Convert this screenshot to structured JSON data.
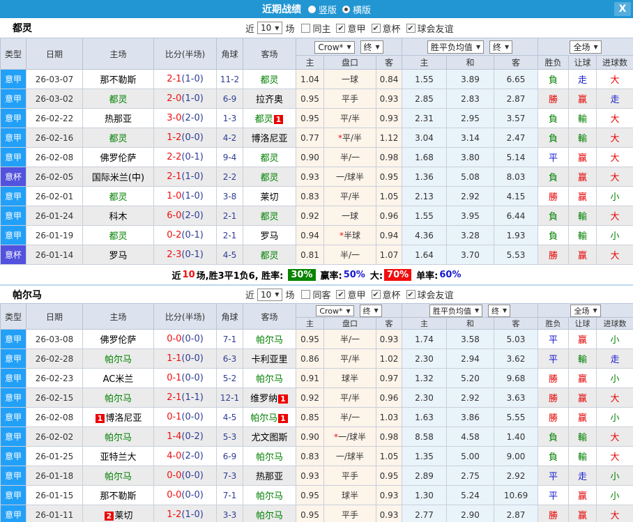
{
  "topbar": {
    "title": "近期战绩",
    "radio_vertical": "竖版",
    "radio_horizontal": "横版",
    "close_label": "X"
  },
  "filter_labels": {
    "near": "近",
    "games": "场"
  },
  "dropdowns": {
    "book": "Crow*",
    "book_time": "终",
    "avg": "胜平负均值",
    "avg_time": "终",
    "scope": "全场",
    "arrow": "▼"
  },
  "columns": {
    "type": "类型",
    "date": "日期",
    "home": "主场",
    "score": "比分(半场)",
    "corners": "角球",
    "away": "客场",
    "odds_home": "主",
    "handicap": "盘口",
    "odds_away": "客",
    "avg_home": "主",
    "avg_draw": "和",
    "avg_away": "客",
    "wdl": "胜负",
    "hcp_result": "让球",
    "goals": "进球数"
  },
  "colors": {
    "league_blue": "#22a0f8",
    "cup_purple": "#5252de",
    "win_red": "#e60000",
    "lose_green": "#008000",
    "draw_blue": "#1518cf",
    "topbar_blue": "#2196d3"
  },
  "sections": [
    {
      "team": "都灵",
      "filter": {
        "count": "10",
        "same": "同主",
        "leagues": [
          "意甲",
          "意杯",
          "球会友谊"
        ]
      },
      "rows": [
        {
          "lg": "意甲",
          "cup": false,
          "date": "26-03-07",
          "home": {
            "t": "那不勒斯"
          },
          "ft": "2-1",
          "ht": "(1-0)",
          "cr": "11-2",
          "away": {
            "t": "都灵",
            "g": true
          },
          "o1": "1.04",
          "hc": "一球",
          "star": false,
          "o2": "0.84",
          "avg": [
            "1.55",
            "3.89",
            "6.65"
          ],
          "res": [
            [
              "負",
              "g"
            ],
            [
              "走",
              "b"
            ],
            [
              "大",
              "r"
            ]
          ]
        },
        {
          "lg": "意甲",
          "cup": false,
          "date": "26-03-02",
          "home": {
            "t": "都灵",
            "g": true
          },
          "ft": "2-0",
          "ht": "(1-0)",
          "cr": "6-9",
          "away": {
            "t": "拉齐奥"
          },
          "o1": "0.95",
          "hc": "平手",
          "star": false,
          "o2": "0.93",
          "avg": [
            "2.85",
            "2.83",
            "2.87"
          ],
          "res": [
            [
              "勝",
              "r"
            ],
            [
              "赢",
              "r"
            ],
            [
              "走",
              "b"
            ]
          ]
        },
        {
          "lg": "意甲",
          "cup": false,
          "date": "26-02-22",
          "home": {
            "t": "热那亚"
          },
          "ft": "3-0",
          "ht": "(2-0)",
          "cr": "1-3",
          "away": {
            "t": "都灵",
            "g": true,
            "b": "1",
            "bp": "after"
          },
          "o1": "0.95",
          "hc": "平/半",
          "star": false,
          "o2": "0.93",
          "avg": [
            "2.31",
            "2.95",
            "3.57"
          ],
          "res": [
            [
              "負",
              "g"
            ],
            [
              "輸",
              "g"
            ],
            [
              "大",
              "r"
            ]
          ]
        },
        {
          "lg": "意甲",
          "cup": false,
          "date": "26-02-16",
          "home": {
            "t": "都灵",
            "g": true
          },
          "ft": "1-2",
          "ht": "(0-0)",
          "cr": "4-2",
          "away": {
            "t": "博洛尼亚"
          },
          "o1": "0.77",
          "hc": "平/半",
          "star": true,
          "o2": "1.12",
          "avg": [
            "3.04",
            "3.14",
            "2.47"
          ],
          "res": [
            [
              "負",
              "g"
            ],
            [
              "輸",
              "g"
            ],
            [
              "大",
              "r"
            ]
          ]
        },
        {
          "lg": "意甲",
          "cup": false,
          "date": "26-02-08",
          "home": {
            "t": "佛罗伦萨"
          },
          "ft": "2-2",
          "ht": "(0-1)",
          "cr": "9-4",
          "away": {
            "t": "都灵",
            "g": true
          },
          "o1": "0.90",
          "hc": "半/一",
          "star": false,
          "o2": "0.98",
          "avg": [
            "1.68",
            "3.80",
            "5.14"
          ],
          "res": [
            [
              "平",
              "b"
            ],
            [
              "赢",
              "r"
            ],
            [
              "大",
              "r"
            ]
          ]
        },
        {
          "lg": "意杯",
          "cup": true,
          "date": "26-02-05",
          "home": {
            "t": "国际米兰(中)"
          },
          "ft": "2-1",
          "ht": "(1-0)",
          "cr": "2-2",
          "away": {
            "t": "都灵",
            "g": true
          },
          "o1": "0.93",
          "hc": "一/球半",
          "star": false,
          "o2": "0.95",
          "avg": [
            "1.36",
            "5.08",
            "8.03"
          ],
          "res": [
            [
              "負",
              "g"
            ],
            [
              "赢",
              "r"
            ],
            [
              "大",
              "r"
            ]
          ]
        },
        {
          "lg": "意甲",
          "cup": false,
          "date": "26-02-01",
          "home": {
            "t": "都灵",
            "g": true
          },
          "ft": "1-0",
          "ht": "(1-0)",
          "cr": "3-8",
          "away": {
            "t": "莱切"
          },
          "o1": "0.83",
          "hc": "平/半",
          "star": false,
          "o2": "1.05",
          "avg": [
            "2.13",
            "2.92",
            "4.15"
          ],
          "res": [
            [
              "勝",
              "r"
            ],
            [
              "赢",
              "r"
            ],
            [
              "小",
              "g"
            ]
          ]
        },
        {
          "lg": "意甲",
          "cup": false,
          "date": "26-01-24",
          "home": {
            "t": "科木"
          },
          "ft": "6-0",
          "ht": "(2-0)",
          "cr": "2-1",
          "away": {
            "t": "都灵",
            "g": true
          },
          "o1": "0.92",
          "hc": "一球",
          "star": false,
          "o2": "0.96",
          "avg": [
            "1.55",
            "3.95",
            "6.44"
          ],
          "res": [
            [
              "負",
              "g"
            ],
            [
              "輸",
              "g"
            ],
            [
              "大",
              "r"
            ]
          ]
        },
        {
          "lg": "意甲",
          "cup": false,
          "date": "26-01-19",
          "home": {
            "t": "都灵",
            "g": true
          },
          "ft": "0-2",
          "ht": "(0-1)",
          "cr": "2-1",
          "away": {
            "t": "罗马"
          },
          "o1": "0.94",
          "hc": "半球",
          "star": true,
          "o2": "0.94",
          "avg": [
            "4.36",
            "3.28",
            "1.93"
          ],
          "res": [
            [
              "負",
              "g"
            ],
            [
              "輸",
              "g"
            ],
            [
              "小",
              "g"
            ]
          ]
        },
        {
          "lg": "意杯",
          "cup": true,
          "date": "26-01-14",
          "home": {
            "t": "罗马"
          },
          "ft": "2-3",
          "ht": "(0-1)",
          "cr": "4-5",
          "away": {
            "t": "都灵",
            "g": true
          },
          "o1": "0.81",
          "hc": "半/一",
          "star": false,
          "o2": "1.07",
          "avg": [
            "1.64",
            "3.70",
            "5.53"
          ],
          "res": [
            [
              "勝",
              "r"
            ],
            [
              "赢",
              "r"
            ],
            [
              "大",
              "r"
            ]
          ]
        }
      ],
      "summary": {
        "near": "近",
        "count": "10",
        "seg1": "场,胜3平1负6, 胜率:",
        "win_rate": "30%",
        "seg2": "赢率:",
        "v2": "50%",
        "seg3": "大:",
        "v3": "70%",
        "seg4": "单率:",
        "v4": "60%"
      }
    },
    {
      "team": "帕尔马",
      "filter": {
        "count": "10",
        "same": "同客",
        "leagues": [
          "意甲",
          "意杯",
          "球会友谊"
        ]
      },
      "rows": [
        {
          "lg": "意甲",
          "cup": false,
          "date": "26-03-08",
          "home": {
            "t": "佛罗伦萨"
          },
          "ft": "0-0",
          "ht": "(0-0)",
          "cr": "7-1",
          "away": {
            "t": "帕尔马",
            "g": true
          },
          "o1": "0.95",
          "hc": "半/一",
          "star": false,
          "o2": "0.93",
          "avg": [
            "1.74",
            "3.58",
            "5.03"
          ],
          "res": [
            [
              "平",
              "b"
            ],
            [
              "赢",
              "r"
            ],
            [
              "小",
              "g"
            ]
          ]
        },
        {
          "lg": "意甲",
          "cup": false,
          "date": "26-02-28",
          "home": {
            "t": "帕尔马",
            "g": true
          },
          "ft": "1-1",
          "ht": "(0-0)",
          "cr": "6-3",
          "away": {
            "t": "卡利亚里"
          },
          "o1": "0.86",
          "hc": "平/半",
          "star": false,
          "o2": "1.02",
          "avg": [
            "2.30",
            "2.94",
            "3.62"
          ],
          "res": [
            [
              "平",
              "b"
            ],
            [
              "輸",
              "g"
            ],
            [
              "走",
              "b"
            ]
          ]
        },
        {
          "lg": "意甲",
          "cup": false,
          "date": "26-02-23",
          "home": {
            "t": "AC米兰"
          },
          "ft": "0-1",
          "ht": "(0-0)",
          "cr": "5-2",
          "away": {
            "t": "帕尔马",
            "g": true
          },
          "o1": "0.91",
          "hc": "球半",
          "star": false,
          "o2": "0.97",
          "avg": [
            "1.32",
            "5.20",
            "9.68"
          ],
          "res": [
            [
              "勝",
              "r"
            ],
            [
              "赢",
              "r"
            ],
            [
              "小",
              "g"
            ]
          ]
        },
        {
          "lg": "意甲",
          "cup": false,
          "date": "26-02-15",
          "home": {
            "t": "帕尔马",
            "g": true
          },
          "ft": "2-1",
          "ht": "(1-1)",
          "cr": "12-1",
          "away": {
            "t": "维罗纳",
            "b": "1",
            "bp": "after"
          },
          "o1": "0.92",
          "hc": "平/半",
          "star": false,
          "o2": "0.96",
          "avg": [
            "2.30",
            "2.92",
            "3.63"
          ],
          "res": [
            [
              "勝",
              "r"
            ],
            [
              "赢",
              "r"
            ],
            [
              "大",
              "r"
            ]
          ]
        },
        {
          "lg": "意甲",
          "cup": false,
          "date": "26-02-08",
          "home": {
            "t": "博洛尼亚",
            "b": "1",
            "bp": "before"
          },
          "ft": "0-1",
          "ht": "(0-0)",
          "cr": "4-5",
          "away": {
            "t": "帕尔马",
            "g": true,
            "b": "1",
            "bp": "after"
          },
          "o1": "0.85",
          "hc": "半/一",
          "star": false,
          "o2": "1.03",
          "avg": [
            "1.63",
            "3.86",
            "5.55"
          ],
          "res": [
            [
              "勝",
              "r"
            ],
            [
              "赢",
              "r"
            ],
            [
              "小",
              "g"
            ]
          ]
        },
        {
          "lg": "意甲",
          "cup": false,
          "date": "26-02-02",
          "home": {
            "t": "帕尔马",
            "g": true
          },
          "ft": "1-4",
          "ht": "(0-2)",
          "cr": "5-3",
          "away": {
            "t": "尤文图斯"
          },
          "o1": "0.90",
          "hc": "一/球半",
          "star": true,
          "o2": "0.98",
          "avg": [
            "8.58",
            "4.58",
            "1.40"
          ],
          "res": [
            [
              "負",
              "g"
            ],
            [
              "輸",
              "g"
            ],
            [
              "大",
              "r"
            ]
          ]
        },
        {
          "lg": "意甲",
          "cup": false,
          "date": "26-01-25",
          "home": {
            "t": "亚特兰大"
          },
          "ft": "4-0",
          "ht": "(2-0)",
          "cr": "6-9",
          "away": {
            "t": "帕尔马",
            "g": true
          },
          "o1": "0.83",
          "hc": "一/球半",
          "star": false,
          "o2": "1.05",
          "avg": [
            "1.35",
            "5.00",
            "9.00"
          ],
          "res": [
            [
              "負",
              "g"
            ],
            [
              "輸",
              "g"
            ],
            [
              "大",
              "r"
            ]
          ]
        },
        {
          "lg": "意甲",
          "cup": false,
          "date": "26-01-18",
          "home": {
            "t": "帕尔马",
            "g": true
          },
          "ft": "0-0",
          "ht": "(0-0)",
          "cr": "7-3",
          "away": {
            "t": "热那亚"
          },
          "o1": "0.93",
          "hc": "平手",
          "star": false,
          "o2": "0.95",
          "avg": [
            "2.89",
            "2.75",
            "2.92"
          ],
          "res": [
            [
              "平",
              "b"
            ],
            [
              "走",
              "b"
            ],
            [
              "小",
              "g"
            ]
          ]
        },
        {
          "lg": "意甲",
          "cup": false,
          "date": "26-01-15",
          "home": {
            "t": "那不勒斯"
          },
          "ft": "0-0",
          "ht": "(0-0)",
          "cr": "7-1",
          "away": {
            "t": "帕尔马",
            "g": true
          },
          "o1": "0.95",
          "hc": "球半",
          "star": false,
          "o2": "0.93",
          "avg": [
            "1.30",
            "5.24",
            "10.69"
          ],
          "res": [
            [
              "平",
              "b"
            ],
            [
              "赢",
              "r"
            ],
            [
              "小",
              "g"
            ]
          ]
        },
        {
          "lg": "意甲",
          "cup": false,
          "date": "26-01-11",
          "home": {
            "t": "莱切",
            "b": "2",
            "bp": "before"
          },
          "ft": "1-2",
          "ht": "(1-0)",
          "cr": "3-3",
          "away": {
            "t": "帕尔马",
            "g": true
          },
          "o1": "0.95",
          "hc": "平手",
          "star": false,
          "o2": "0.93",
          "avg": [
            "2.77",
            "2.90",
            "2.87"
          ],
          "res": [
            [
              "勝",
              "r"
            ],
            [
              "赢",
              "r"
            ],
            [
              "大",
              "r"
            ]
          ]
        }
      ]
    }
  ]
}
